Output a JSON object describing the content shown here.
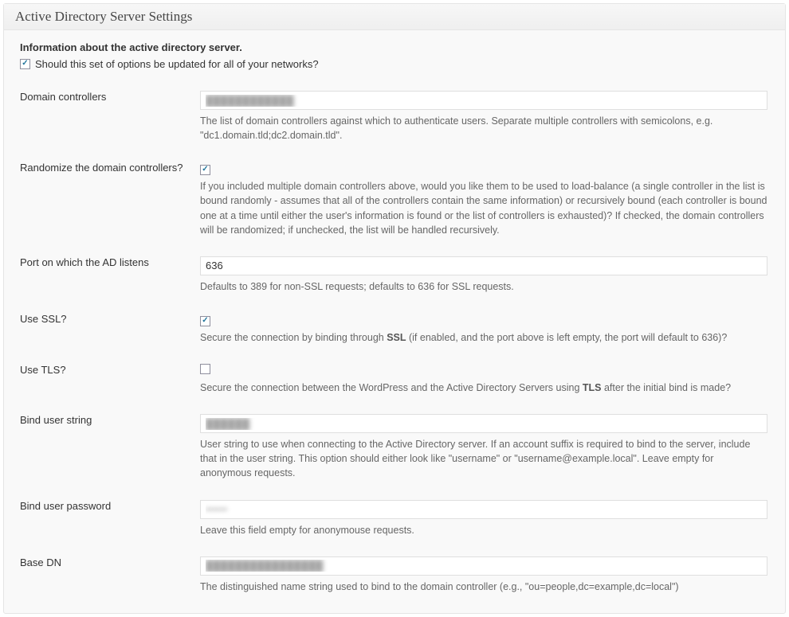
{
  "panel": {
    "title": "Active Directory Server Settings"
  },
  "info": {
    "heading": "Information about the active directory server.",
    "update_all_label": "Should this set of options be updated for all of your networks?",
    "update_all_checked": true
  },
  "fields": {
    "domain_controllers": {
      "label": "Domain controllers",
      "value": "████████████",
      "desc": "The list of domain controllers against which to authenticate users. Separate multiple controllers with semicolons, e.g. \"dc1.domain.tld;dc2.domain.tld\"."
    },
    "randomize": {
      "label": "Randomize the domain controllers?",
      "checked": true,
      "desc": "If you included multiple domain controllers above, would you like them to be used to load-balance (a single controller in the list is bound randomly - assumes that all of the controllers contain the same information) or recursively bound (each controller is bound one at a time until either the user's information is found or the list of controllers is exhausted)? If checked, the domain controllers will be randomized; if unchecked, the list will be handled recursively."
    },
    "port": {
      "label": "Port on which the AD listens",
      "value": "636",
      "desc": "Defaults to 389 for non-SSL requests; defaults to 636 for SSL requests."
    },
    "use_ssl": {
      "label": "Use SSL?",
      "checked": true,
      "desc_pre": "Secure the connection by binding through ",
      "desc_bold": "SSL",
      "desc_post": " (if enabled, and the port above is left empty, the port will default to 636)?"
    },
    "use_tls": {
      "label": "Use TLS?",
      "checked": false,
      "desc_pre": "Secure the connection between the WordPress and the Active Directory Servers using ",
      "desc_bold": "TLS",
      "desc_post": " after the initial bind is made?"
    },
    "bind_user": {
      "label": "Bind user string",
      "value": "██████",
      "desc": "User string to use when connecting to the Active Directory server. If an account suffix is required to bind to the server, include that in the user string. This option should either look like \"username\" or \"username@example.local\". Leave empty for anonymous requests."
    },
    "bind_pass": {
      "label": "Bind user password",
      "value": "██████",
      "desc": "Leave this field empty for anonymouse requests."
    },
    "base_dn": {
      "label": "Base DN",
      "value": "████████████████",
      "desc": "The distinguished name string used to bind to the domain controller (e.g., \"ou=people,dc=example,dc=local\")"
    }
  }
}
